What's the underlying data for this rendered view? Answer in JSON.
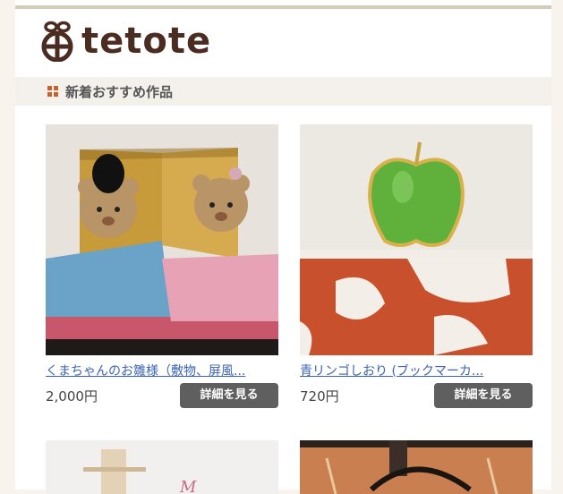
{
  "brand": {
    "name": "tetote"
  },
  "section": {
    "title": "新着おすすめ作品"
  },
  "products": [
    {
      "name": "くまちゃんのお雛様（敷物、屏風...",
      "price": "2,000円",
      "button": "詳細を見る"
    },
    {
      "name": "青リンゴしおり (ブックマーカ...",
      "price": "720円",
      "button": "詳細を見る"
    }
  ],
  "colors": {
    "accent": "#c8622c",
    "logo": "#4a2c21",
    "button": "#5f5f5f",
    "link": "#3a63b6"
  }
}
